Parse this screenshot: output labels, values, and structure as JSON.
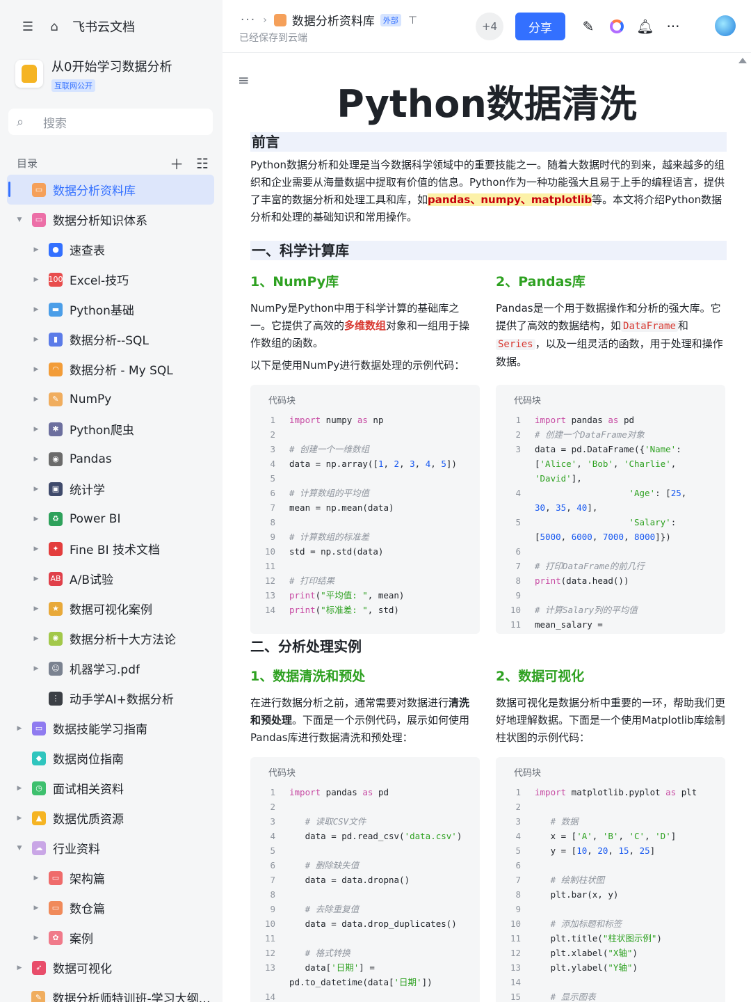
{
  "sidebar": {
    "brand": "飞书云文档",
    "space_title": "从0开始学习数据分析",
    "space_badge": "互联网公开",
    "search_placeholder": "搜索",
    "toc_label": "目录",
    "items": [
      {
        "label": "数据分析资料库",
        "level": 0,
        "caret": "",
        "icon": "doc-orange-icon",
        "color": "#f5a05a",
        "glyph": "▭",
        "active": true
      },
      {
        "label": "数据分析知识体系",
        "level": 0,
        "caret": "▼",
        "icon": "pink-box-icon",
        "color": "#ec6fa7",
        "glyph": "▭"
      },
      {
        "label": "速查表",
        "level": 1,
        "caret": "▶",
        "icon": "magnifier-icon",
        "color": "#3370ff",
        "glyph": "●"
      },
      {
        "label": "Excel-技巧",
        "level": 1,
        "caret": "▶",
        "icon": "hundred-icon",
        "color": "#e84d4d",
        "glyph": "100"
      },
      {
        "label": "Python基础",
        "level": 1,
        "caret": "▶",
        "icon": "computer-icon",
        "color": "#4b9ee8",
        "glyph": "▬"
      },
      {
        "label": "数据分析--SQL",
        "level": 1,
        "caret": "▶",
        "icon": "bar-chart-icon",
        "color": "#5b7be8",
        "glyph": "▮"
      },
      {
        "label": "数据分析 - My SQL",
        "level": 1,
        "caret": "▶",
        "icon": "rainbow-icon",
        "color": "#f29c38",
        "glyph": "◠"
      },
      {
        "label": "NumPy",
        "level": 1,
        "caret": "▶",
        "icon": "memo-icon",
        "color": "#f0ad5e",
        "glyph": "✎"
      },
      {
        "label": "Python爬虫",
        "level": 1,
        "caret": "▶",
        "icon": "spider-icon",
        "color": "#6c6f9e",
        "glyph": "✱"
      },
      {
        "label": "Pandas",
        "level": 1,
        "caret": "▶",
        "icon": "panda-icon",
        "color": "#6b6b6b",
        "glyph": "◉"
      },
      {
        "label": "统计学",
        "level": 1,
        "caret": "▶",
        "icon": "floppy-icon",
        "color": "#3f4a6b",
        "glyph": "▣"
      },
      {
        "label": "Power BI",
        "level": 1,
        "caret": "▶",
        "icon": "recycle-icon",
        "color": "#2ea15b",
        "glyph": "♻"
      },
      {
        "label": "Fine BI 技术文档",
        "level": 1,
        "caret": "▶",
        "icon": "pushpin-icon",
        "color": "#e33d3d",
        "glyph": "✦"
      },
      {
        "label": "A/B试验",
        "level": 1,
        "caret": "▶",
        "icon": "ab-icon",
        "color": "#e0404a",
        "glyph": "AB"
      },
      {
        "label": "数据可视化案例",
        "level": 1,
        "caret": "▶",
        "icon": "medal-icon",
        "color": "#e8a93a",
        "glyph": "★"
      },
      {
        "label": "数据分析十大方法论",
        "level": 1,
        "caret": "▶",
        "icon": "sparkle-icon",
        "color": "#a2c84a",
        "glyph": "✺"
      },
      {
        "label": "机器学习.pdf",
        "level": 1,
        "caret": "▶",
        "icon": "robot-icon",
        "color": "#7a8290",
        "glyph": "☺"
      },
      {
        "label": "动手学AI+数据分析",
        "level": 1,
        "caret": "",
        "icon": "traffic-light-icon",
        "color": "#3b3f45",
        "glyph": "⋮"
      },
      {
        "label": "数据技能学习指南",
        "level": 0,
        "caret": "▶",
        "icon": "purple-box-icon",
        "color": "#8f7bf0",
        "glyph": "▭"
      },
      {
        "label": "数据岗位指南",
        "level": 0,
        "caret": "",
        "icon": "teal-box-icon",
        "color": "#2fc5be",
        "glyph": "◆"
      },
      {
        "label": "面试相关资料",
        "level": 0,
        "caret": "▶",
        "icon": "green-box-icon",
        "color": "#3ec06e",
        "glyph": "◷"
      },
      {
        "label": "数据优质资源",
        "level": 0,
        "caret": "▶",
        "icon": "thumbs-up-icon",
        "color": "#f5b423",
        "glyph": "▲"
      },
      {
        "label": "行业资料",
        "level": 0,
        "caret": "▼",
        "icon": "ghost-icon",
        "color": "#c9a6e6",
        "glyph": "☁"
      },
      {
        "label": "架构篇",
        "level": 1,
        "caret": "▶",
        "icon": "red-box-icon",
        "color": "#ef6b6b",
        "glyph": "▭"
      },
      {
        "label": "数仓篇",
        "level": 1,
        "caret": "▶",
        "icon": "orange-box-icon",
        "color": "#f08a5a",
        "glyph": "▭"
      },
      {
        "label": "案例",
        "level": 1,
        "caret": "▶",
        "icon": "pink-gear-icon",
        "color": "#f07a8a",
        "glyph": "✿"
      },
      {
        "label": "数据可视化",
        "level": 0,
        "caret": "▶",
        "icon": "rocket-icon",
        "color": "#e84d6a",
        "glyph": "➶"
      },
      {
        "label": "数据分析师特训班-学习大纲（...",
        "level": 0,
        "caret": "",
        "icon": "memo-icon",
        "color": "#f0ad5e",
        "glyph": "✎"
      }
    ]
  },
  "topbar": {
    "crumb_more": "···",
    "doc_name": "数据分析资料库",
    "ext_badge": "外部",
    "saved": "已经保存到云端",
    "collaborators": "+4",
    "share": "分享"
  },
  "doc": {
    "title": "Python数据清洗",
    "preface_heading": "前言",
    "preface": {
      "p1": "Python数据分析和处理是当今数据科学领域中的重要技能之一。随着大数据时代的到来，越来越多的组织和企业需要从海量数据中提取有价值的信息。Python作为一种功能强大且易于上手的编程语言，提供了丰富的数据分析和处理工具和库，如",
      "hl": "pandas、numpy、matplotlib",
      "p2": "等。本文将介绍Python数据分析和处理的基础知识和常用操作。"
    },
    "sec1_heading": "一、科学计算库",
    "numpy": {
      "heading": "1、NumPy库",
      "t1": "NumPy是Python中用于科学计算的基础库之一。它提供了高效的",
      "red": "多维数组",
      "t2": "对象和一组用于操作数组的函数。",
      "intro": "以下是使用NumPy进行数据处理的示例代码："
    },
    "pandas": {
      "heading": "2、Pandas库",
      "t1": "Pandas是一个用于数据操作和分析的强大库。它提供了高效的数据结构，如",
      "code1": "DataFrame",
      "t2": "和",
      "code2": "Series",
      "t3": "，以及一组灵活的函数，用于处理和操作数据。"
    },
    "sec2_heading": "二、分析处理实例",
    "clean": {
      "heading": "1、数据清洗和预处",
      "t1": "在进行数据分析之前，通常需要对数据进行",
      "bold": "清洗和预处理",
      "t2": "。下面是一个示例代码，展示如何使用Pandas库进行数据清洗和预处理："
    },
    "viz": {
      "heading": "2、数据可视化",
      "text": "数据可视化是数据分析中重要的一环，帮助我们更好地理解数据。下面是一个使用Matplotlib库绘制柱状图的示例代码："
    },
    "code_label": "代码块",
    "code_blocks": {
      "numpy": [
        {
          "n": "1",
          "t": "<span class='kw'>import</span> numpy <span class='kw'>as</span> np"
        },
        {
          "n": "2",
          "t": ""
        },
        {
          "n": "3",
          "t": "<span class='cm'># 创建一个一维数组</span>"
        },
        {
          "n": "4",
          "t": "data = np.array([<span class='nm'>1</span>, <span class='nm'>2</span>, <span class='nm'>3</span>, <span class='nm'>4</span>, <span class='nm'>5</span>])"
        },
        {
          "n": "5",
          "t": ""
        },
        {
          "n": "6",
          "t": "<span class='cm'># 计算数组的平均值</span>"
        },
        {
          "n": "7",
          "t": "mean = np.mean(data)"
        },
        {
          "n": "8",
          "t": ""
        },
        {
          "n": "9",
          "t": "<span class='cm'># 计算数组的标准差</span>"
        },
        {
          "n": "10",
          "t": "std = np.std(data)"
        },
        {
          "n": "11",
          "t": ""
        },
        {
          "n": "12",
          "t": "<span class='cm'># 打印结果</span>"
        },
        {
          "n": "13",
          "t": "<span class='kw'>print</span>(<span class='st'>\"平均值: \"</span>, mean)"
        },
        {
          "n": "14",
          "t": "<span class='kw'>print</span>(<span class='st'>\"标准差: \"</span>, std)"
        }
      ],
      "pandas": [
        {
          "n": "1",
          "t": "<span class='kw'>import</span> pandas <span class='kw'>as</span> pd"
        },
        {
          "n": "2",
          "t": "<span class='cm'># 创建一个DataFrame对象</span>"
        },
        {
          "n": "3",
          "t": "data = pd.DataFrame({<span class='st'>'Name'</span>:"
        },
        {
          "n": "",
          "t": "[<span class='st'>'Alice'</span>, <span class='st'>'Bob'</span>, <span class='st'>'Charlie'</span>,"
        },
        {
          "n": "",
          "t": "<span class='st'>'David'</span>],"
        },
        {
          "n": "4",
          "t": "                  <span class='st'>'Age'</span>: [<span class='nm'>25</span>,"
        },
        {
          "n": "",
          "t": "<span class='nm'>30</span>, <span class='nm'>35</span>, <span class='nm'>40</span>],"
        },
        {
          "n": "5",
          "t": "                  <span class='st'>'Salary'</span>:"
        },
        {
          "n": "",
          "t": "[<span class='nm'>5000</span>, <span class='nm'>6000</span>, <span class='nm'>7000</span>, <span class='nm'>8000</span>]})"
        },
        {
          "n": "6",
          "t": ""
        },
        {
          "n": "7",
          "t": "<span class='cm'># 打印DataFrame的前几行</span>"
        },
        {
          "n": "8",
          "t": "<span class='kw'>print</span>(data.head())"
        },
        {
          "n": "9",
          "t": ""
        },
        {
          "n": "10",
          "t": "<span class='cm'># 计算Salary列的平均值</span>"
        },
        {
          "n": "11",
          "t": "mean_salary ="
        }
      ],
      "clean": [
        {
          "n": "1",
          "t": "<span class='kw'>import</span> pandas <span class='kw'>as</span> pd"
        },
        {
          "n": "2",
          "t": ""
        },
        {
          "n": "3",
          "t": "   <span class='cm'># 读取CSV文件</span>"
        },
        {
          "n": "4",
          "t": "   data = pd.read_csv(<span class='st'>'data.csv'</span>)"
        },
        {
          "n": "5",
          "t": ""
        },
        {
          "n": "6",
          "t": "   <span class='cm'># 删除缺失值</span>"
        },
        {
          "n": "7",
          "t": "   data = data.dropna()"
        },
        {
          "n": "8",
          "t": ""
        },
        {
          "n": "9",
          "t": "   <span class='cm'># 去除重复值</span>"
        },
        {
          "n": "10",
          "t": "   data = data.drop_duplicates()"
        },
        {
          "n": "11",
          "t": ""
        },
        {
          "n": "12",
          "t": "   <span class='cm'># 格式转换</span>"
        },
        {
          "n": "13",
          "t": "   data[<span class='st'>'日期'</span>] ="
        },
        {
          "n": "",
          "t": "pd.to_datetime(data[<span class='st'>'日期'</span>])"
        },
        {
          "n": "14",
          "t": ""
        }
      ],
      "viz": [
        {
          "n": "1",
          "t": "<span class='kw'>import</span> matplotlib.pyplot <span class='kw'>as</span> plt"
        },
        {
          "n": "2",
          "t": ""
        },
        {
          "n": "3",
          "t": "   <span class='cm'># 数据</span>"
        },
        {
          "n": "4",
          "t": "   x = [<span class='st'>'A'</span>, <span class='st'>'B'</span>, <span class='st'>'C'</span>, <span class='st'>'D'</span>]"
        },
        {
          "n": "5",
          "t": "   y = [<span class='nm'>10</span>, <span class='nm'>20</span>, <span class='nm'>15</span>, <span class='nm'>25</span>]"
        },
        {
          "n": "6",
          "t": ""
        },
        {
          "n": "7",
          "t": "   <span class='cm'># 绘制柱状图</span>"
        },
        {
          "n": "8",
          "t": "   plt.bar(x, y)"
        },
        {
          "n": "9",
          "t": ""
        },
        {
          "n": "10",
          "t": "   <span class='cm'># 添加标题和标签</span>"
        },
        {
          "n": "11",
          "t": "   plt.title(<span class='st'>\"柱状图示例\"</span>)"
        },
        {
          "n": "12",
          "t": "   plt.xlabel(<span class='st'>\"X轴\"</span>)"
        },
        {
          "n": "13",
          "t": "   plt.ylabel(<span class='st'>\"Y轴\"</span>)"
        },
        {
          "n": "14",
          "t": ""
        },
        {
          "n": "15",
          "t": "   <span class='cm'># 显示图表</span>"
        }
      ]
    }
  }
}
